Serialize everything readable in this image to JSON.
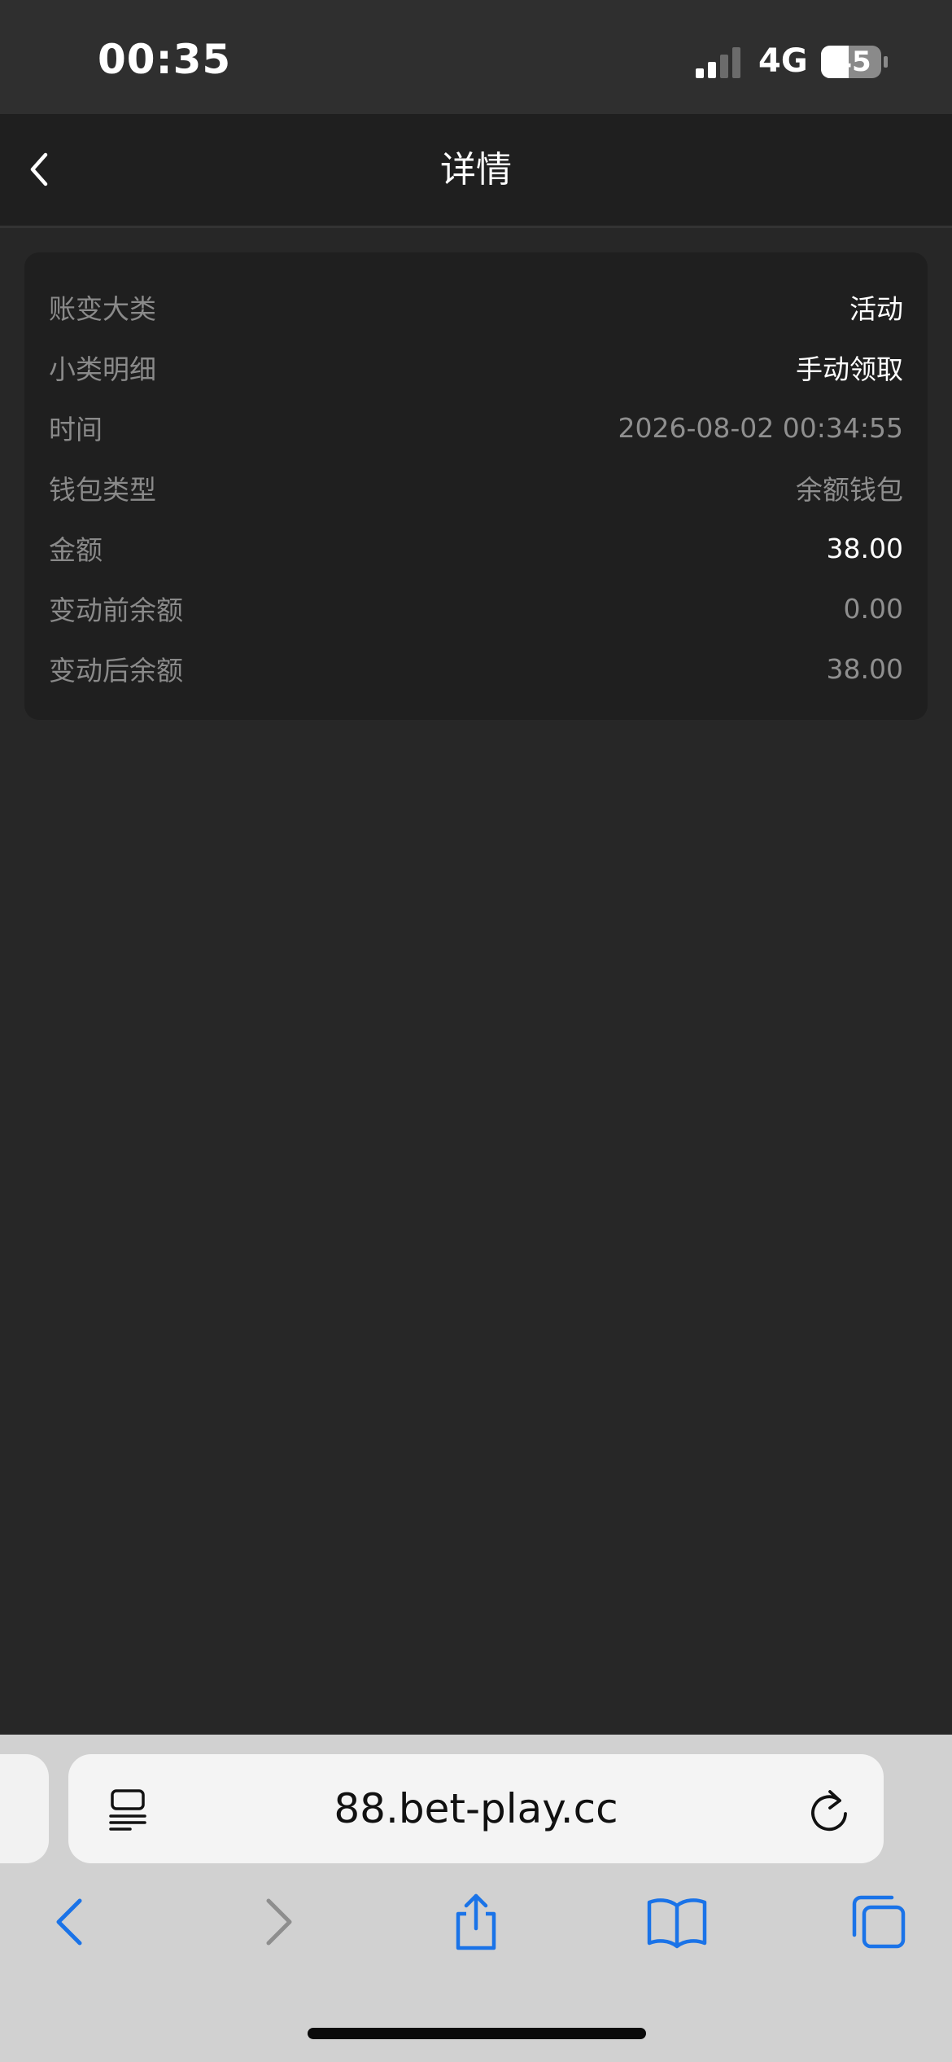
{
  "status_bar": {
    "time": "00:35",
    "network": "4G",
    "battery": "45",
    "battery_level": 0.45
  },
  "nav": {
    "title": "详情",
    "back_icon": "chevron-left-icon"
  },
  "details": [
    {
      "label": "账变大类",
      "value": "活动"
    },
    {
      "label": "小类明细",
      "value": "手动领取"
    },
    {
      "label": "时间",
      "value": "2026-08-02 00:34:55"
    },
    {
      "label": "钱包类型",
      "value": "余额钱包"
    },
    {
      "label": "金额",
      "value": "38.00"
    },
    {
      "label": "变动前余额",
      "value": "0.00"
    },
    {
      "label": "变动后余额",
      "value": "38.00"
    }
  ],
  "browser": {
    "url": "88.bet-play.cc",
    "toolbar_icons": [
      "back-icon",
      "forward-icon",
      "share-icon",
      "bookmarks-icon",
      "tabs-icon"
    ],
    "accent_color": "#1a73e8"
  },
  "colors": {
    "background": "#272727",
    "card": "#1f1f1f",
    "label": "#8a8a8a"
  }
}
